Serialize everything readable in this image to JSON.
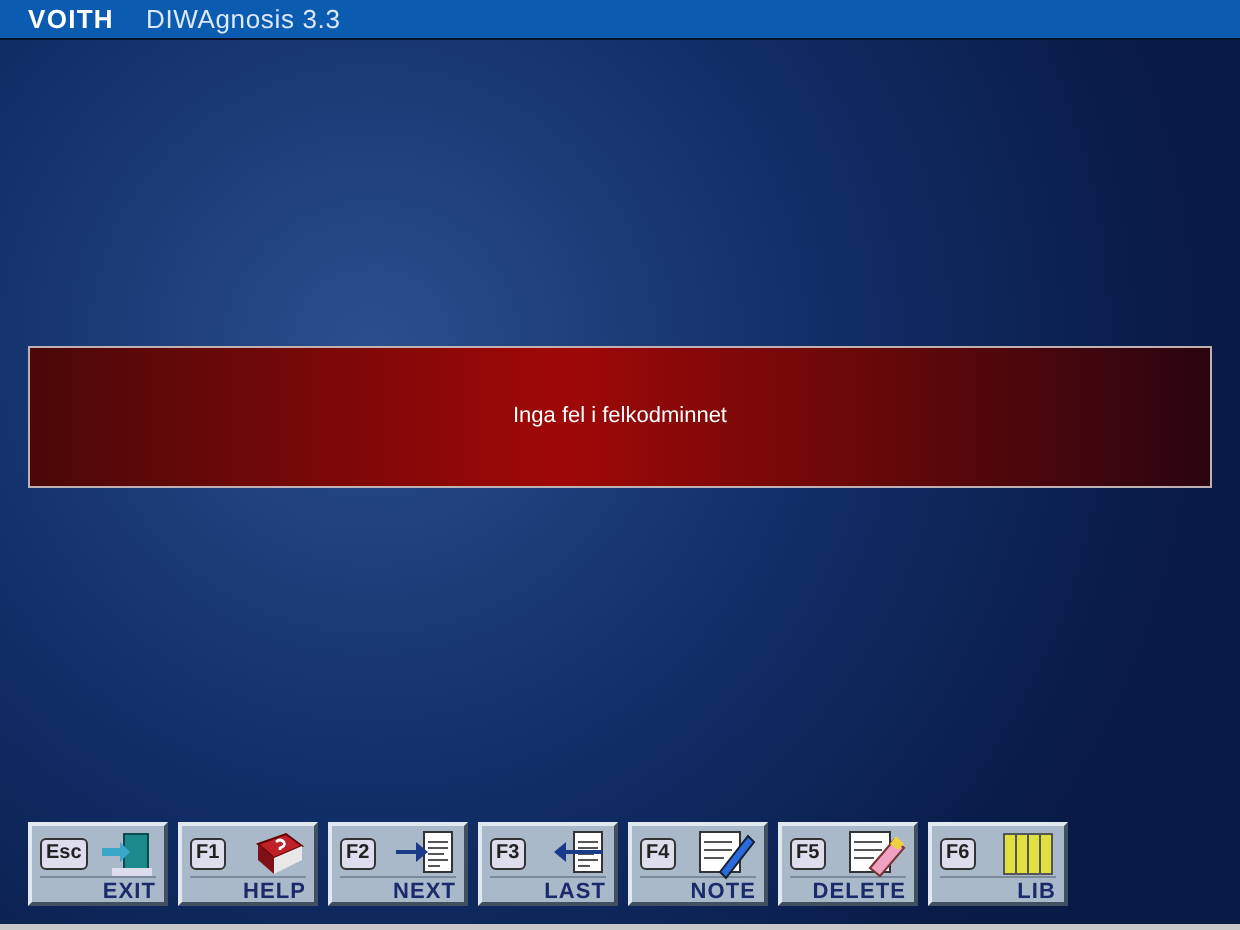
{
  "window": {
    "brand": "VOITH",
    "title": "DIWAgnosis 3.3"
  },
  "message": "Inga fel i felkodminnet",
  "buttons": [
    {
      "key": "Esc",
      "label": "EXIT",
      "kind": "exit"
    },
    {
      "key": "F1",
      "label": "HELP",
      "kind": "help"
    },
    {
      "key": "F2",
      "label": "NEXT",
      "kind": "next"
    },
    {
      "key": "F3",
      "label": "LAST",
      "kind": "last"
    },
    {
      "key": "F4",
      "label": "NOTE",
      "kind": "note"
    },
    {
      "key": "F5",
      "label": "DELETE",
      "kind": "delete"
    },
    {
      "key": "F6",
      "label": "LIB",
      "kind": "lib"
    }
  ]
}
